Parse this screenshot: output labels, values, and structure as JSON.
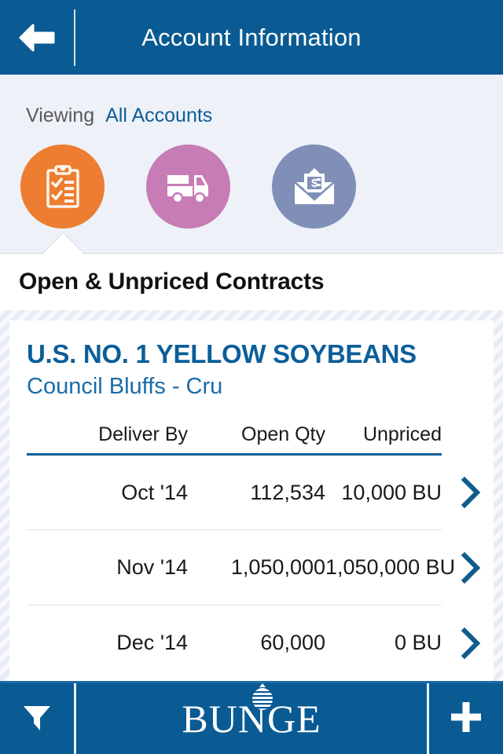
{
  "colors": {
    "brand_blue": "#0a5b93",
    "link_blue": "#0c5e99",
    "panel_bg": "#eef1f8",
    "tab_orange": "#ed7d31",
    "tab_pink": "#c77cb5",
    "tab_slate": "#7f8fb8",
    "chevron_blue": "#105c8c"
  },
  "navbar": {
    "back_icon": "arrow-left-icon",
    "title": "Account Information"
  },
  "viewing": {
    "label": "Viewing",
    "value": "All Accounts"
  },
  "tabs": [
    {
      "icon": "clipboard-check-icon",
      "color": "#ed7d31",
      "selected": true
    },
    {
      "icon": "truck-icon",
      "color": "#c77cb5",
      "selected": false
    },
    {
      "icon": "envelope-dollar-icon",
      "color": "#7f8fb8",
      "selected": false
    }
  ],
  "section": {
    "title": "Open & Unpriced Contracts"
  },
  "card": {
    "title": "U.S. NO. 1 YELLOW SOYBEANS",
    "subtitle": "Council Bluffs - Cru",
    "columns": [
      "Deliver By",
      "Open Qty",
      "Unpriced"
    ],
    "rows": [
      {
        "deliver_by": "Oct '14",
        "open_qty": "112,534",
        "unpriced": "10,000 BU",
        "chevron": "chevron-right-icon"
      },
      {
        "deliver_by": "Nov '14",
        "open_qty": "1,050,000",
        "unpriced": "1,050,000 BU",
        "chevron": "chevron-right-icon"
      },
      {
        "deliver_by": "Dec '14",
        "open_qty": "60,000",
        "unpriced": "0 BU",
        "chevron": "chevron-right-icon"
      }
    ]
  },
  "bottombar": {
    "filter_icon": "filter-funnel-icon",
    "logo_text": "BUNGE",
    "logo_mark": "bunge-grain-icon",
    "add_icon": "plus-icon"
  }
}
